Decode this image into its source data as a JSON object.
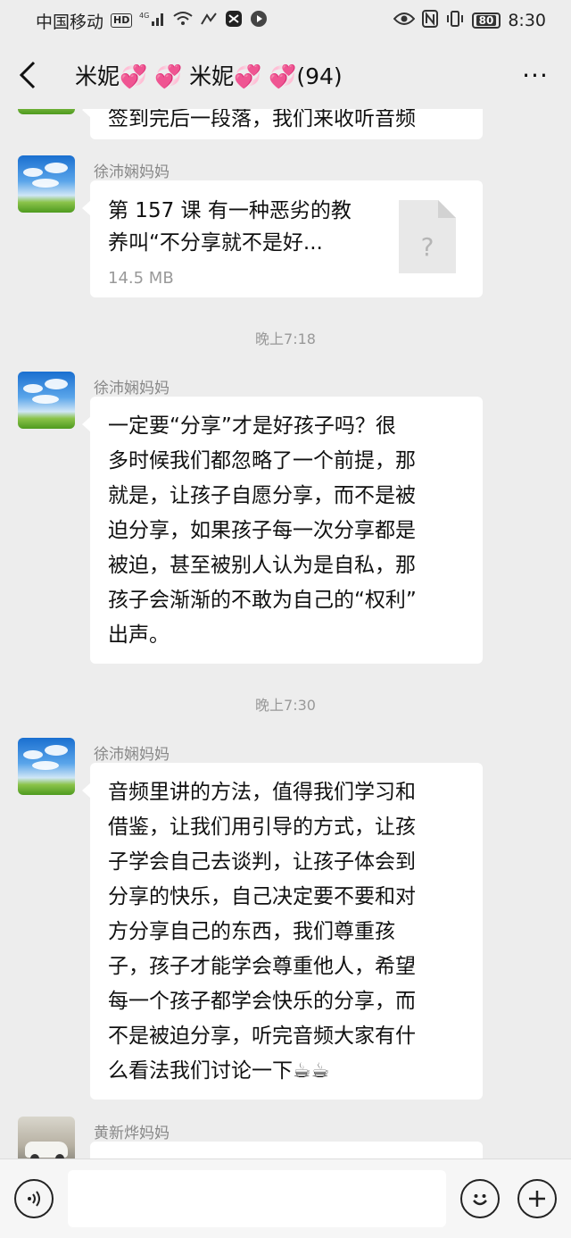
{
  "status": {
    "carrier": "中国移动",
    "hd": "HD",
    "network": "4G",
    "battery": "80",
    "time": "8:30"
  },
  "header": {
    "title": "米妮💞 💞 米妮💞 💞(94)",
    "more": "···"
  },
  "messages": {
    "partial_text": "签到完后一段落，我们来收听音频",
    "file_sender": "徐沛娴妈妈",
    "file_title_line1": "第 157 课 有一种恶劣的教",
    "file_title_line2": "养叫“不分享就不是好...",
    "file_size": "14.5 MB",
    "time1": "晚上7:18",
    "msg1_sender": "徐沛娴妈妈",
    "msg1_line1": "一定要“分享”才是好孩子吗？很",
    "msg1_line2": "多时候我们都忽略了一个前提，那",
    "msg1_line3": "就是，让孩子自愿分享，而不是被",
    "msg1_line4": "迫分享，如果孩子每一次分享都是",
    "msg1_line5": "被迫，甚至被别人认为是自私，那",
    "msg1_line6": "孩子会渐渐的不敢为自己的“权利”",
    "msg1_line7": "出声。",
    "time2": "晚上7:30",
    "msg2_sender": "徐沛娴妈妈",
    "msg2_line1": "音频里讲的方法，值得我们学习和",
    "msg2_line2": "借鉴，让我们用引导的方式，让孩",
    "msg2_line3": "子学会自己去谈判，让孩子体会到",
    "msg2_line4": "分享的快乐，自己决定要不要和对",
    "msg2_line5": "方分享自己的东西，我们尊重孩",
    "msg2_line6": "子，孩子才能学会尊重他人，希望",
    "msg2_line7": "每一个孩子都学会快乐的分享，而",
    "msg2_line8": "不是被迫分享，听完音频大家有什",
    "msg2_line9": "么看法我们讨论一下☕☕",
    "msg3_sender": "黄新烨妈妈",
    "file_placeholder": "?"
  }
}
